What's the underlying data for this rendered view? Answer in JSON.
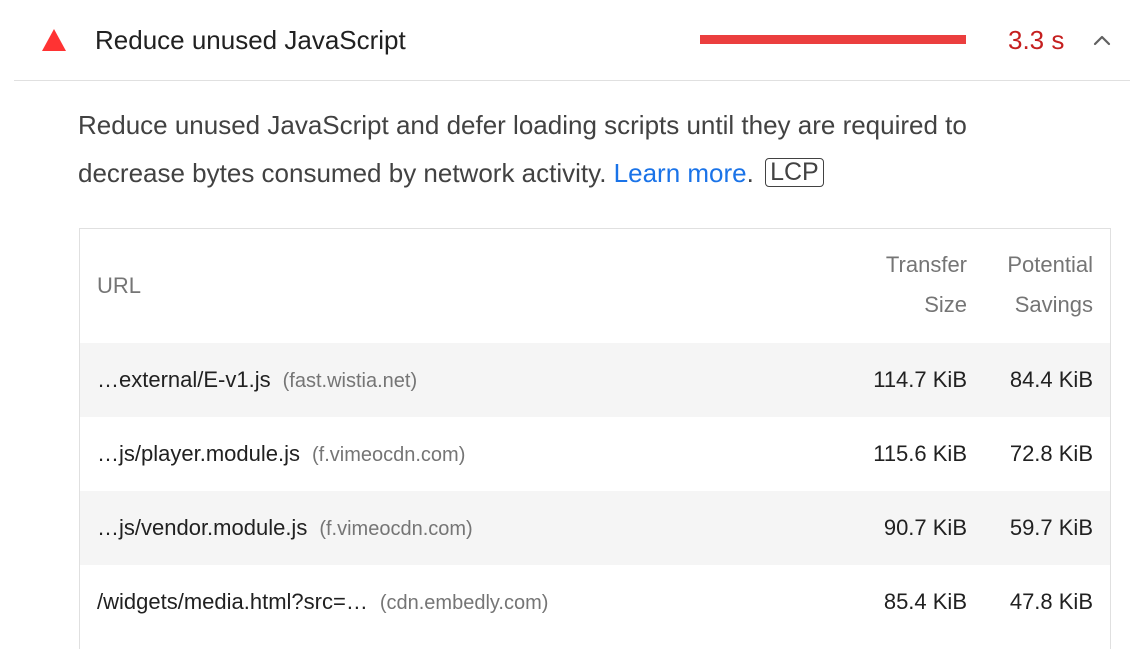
{
  "audit": {
    "title": "Reduce unused JavaScript",
    "value": "3.3 s",
    "status_color": "#eb3e3e",
    "value_color": "#c51f1f",
    "icon": "fail-triangle-icon",
    "expand_icon": "chevron-up-icon"
  },
  "description": {
    "text": "Reduce unused JavaScript and defer loading scripts until they are required to decrease bytes consumed by network activity. ",
    "link_text": "Learn more",
    "period": ".",
    "badge": "LCP"
  },
  "table": {
    "headers": {
      "url": "URL",
      "transfer_size_line1": "Transfer",
      "transfer_size_line2": "Size",
      "savings_line1": "Potential",
      "savings_line2": "Savings"
    },
    "rows": [
      {
        "url": "…external/E-v1.js",
        "host": "(fast.wistia.net)",
        "size": "114.7 KiB",
        "savings": "84.4 KiB"
      },
      {
        "url": "…js/player.module.js",
        "host": "(f.vimeocdn.com)",
        "size": "115.6 KiB",
        "savings": "72.8 KiB"
      },
      {
        "url": "…js/vendor.module.js",
        "host": "(f.vimeocdn.com)",
        "size": "90.7 KiB",
        "savings": "59.7 KiB"
      },
      {
        "url": "/widgets/media.html?src=…",
        "host": "(cdn.embedly.com)",
        "size": "85.4 KiB",
        "savings": "47.8 KiB"
      }
    ]
  }
}
